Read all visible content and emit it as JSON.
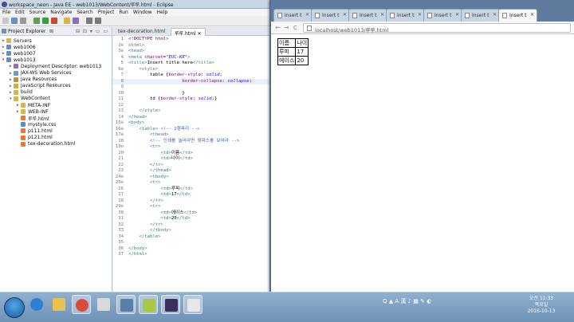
{
  "eclipse": {
    "title": "workspace_neon - Java EE - web1013/WebContent/루루.html - Eclipse",
    "menu": [
      "File",
      "Edit",
      "Source",
      "Navigate",
      "Search",
      "Project",
      "Run",
      "Window",
      "Help"
    ],
    "explorer": {
      "title": "Project Explorer",
      "tab_marker": "⊠",
      "tools": "⊟ ⊡ ▾ ▭ ▭",
      "items": [
        {
          "label": "Servers",
          "indent": 0,
          "twisty": "▸",
          "icon": "folder-icon",
          "color": "#d9b44a"
        },
        {
          "label": "web1006",
          "indent": 0,
          "twisty": "▸",
          "icon": "project-icon",
          "color": "#6c8ebf"
        },
        {
          "label": "web1007",
          "indent": 0,
          "twisty": "▸",
          "icon": "project-icon",
          "color": "#6c8ebf"
        },
        {
          "label": "web1013",
          "indent": 0,
          "twisty": "▾",
          "icon": "project-icon",
          "color": "#6c8ebf"
        },
        {
          "label": "Deployment Descriptor: web1013",
          "indent": 1,
          "twisty": "▸",
          "icon": "descriptor-icon",
          "color": "#8a6fbf"
        },
        {
          "label": "JAX-WS Web Services",
          "indent": 1,
          "twisty": "▸",
          "icon": "webservice-icon",
          "color": "#5aa0d0"
        },
        {
          "label": "Java Resources",
          "indent": 1,
          "twisty": "▸",
          "icon": "java-resources-icon",
          "color": "#c98c3a"
        },
        {
          "label": "JavaScript Resources",
          "indent": 1,
          "twisty": "▸",
          "icon": "js-resources-icon",
          "color": "#c9b23a"
        },
        {
          "label": "build",
          "indent": 1,
          "twisty": "▸",
          "icon": "folder-icon",
          "color": "#d9b44a"
        },
        {
          "label": "WebContent",
          "indent": 1,
          "twisty": "▾",
          "icon": "folder-icon",
          "color": "#d9b44a"
        },
        {
          "label": "META-INF",
          "indent": 2,
          "twisty": "▸",
          "icon": "folder-icon",
          "color": "#d9b44a"
        },
        {
          "label": "WEB-INF",
          "indent": 2,
          "twisty": "▸",
          "icon": "folder-icon",
          "color": "#d9b44a"
        },
        {
          "label": "루루.html",
          "indent": 2,
          "twisty": "",
          "icon": "html-file-icon",
          "color": "#e07a3a"
        },
        {
          "label": "mystyle.css",
          "indent": 2,
          "twisty": "",
          "icon": "css-file-icon",
          "color": "#5a8fd0"
        },
        {
          "label": "p111.html",
          "indent": 2,
          "twisty": "",
          "icon": "html-file-icon",
          "color": "#e07a3a"
        },
        {
          "label": "p121.html",
          "indent": 2,
          "twisty": "",
          "icon": "html-file-icon",
          "color": "#e07a3a"
        },
        {
          "label": "tex-decoration.html",
          "indent": 2,
          "twisty": "",
          "icon": "html-file-icon",
          "color": "#e07a3a"
        }
      ]
    },
    "editor": {
      "tabs": [
        {
          "label": "tex-decoration.html",
          "active": false
        },
        {
          "label": "루루.html ✕",
          "active": true
        }
      ],
      "lines": [
        {
          "n": "1",
          "html": "<span class='cp'>&lt;!DOCTYPE html&gt;</span>"
        },
        {
          "n": "2⊖",
          "html": "<span class='tg'>&lt;html&gt;</span>"
        },
        {
          "n": "3⊖",
          "html": "<span class='tg'>&lt;head&gt;</span>"
        },
        {
          "n": "4",
          "html": "<span class='tg'>&lt;meta</span> <span class='an'>charset</span>=<span class='av'>\"EUC-KR\"</span><span class='tg'>&gt;</span>"
        },
        {
          "n": "5",
          "html": "<span class='tg'>&lt;title&gt;</span><span class='tx'>Insert title here</span><span class='tg'>&lt;/title&gt;</span>"
        },
        {
          "n": "6⊖",
          "html": "    <span class='tg'>&lt;style&gt;</span>"
        },
        {
          "n": "7",
          "html": "        <span class='tx'>table {</span><span class='an'>border-style</span>: <span class='av'>solid</span>;"
        },
        {
          "n": "8",
          "html": "                    <span class='an'>border-collapse</span>: <span class='av'>collapse</span>;",
          "cur": true
        },
        {
          "n": "9",
          "html": " "
        },
        {
          "n": "10",
          "html": "                    <span class='tx'>}</span>"
        },
        {
          "n": "11",
          "html": "        <span class='tx'>td {</span><span class='an'>border-style</span>: <span class='av'>solid</span>;<span class='tx'>}</span>"
        },
        {
          "n": "12",
          "html": " "
        },
        {
          "n": "13",
          "html": "    <span class='tg'>&lt;/style&gt;</span>"
        },
        {
          "n": "14",
          "html": "<span class='tg'>&lt;/head&gt;</span>"
        },
        {
          "n": "15⊖",
          "html": "<span class='tg'>&lt;body&gt;</span>"
        },
        {
          "n": "16⊖",
          "html": "    <span class='tg'>&lt;table&gt;</span> <span class='cm'>&lt;!-- 2행짜리 --&gt;</span>"
        },
        {
          "n": "17⊖",
          "html": "        <span class='tg'>&lt;thead&gt;</span>"
        },
        {
          "n": "18",
          "html": "        <span class='cm'>&lt;!-- 인쇄를 눌러라면 윗파스를 보여라 --&gt;</span>"
        },
        {
          "n": "19⊖",
          "html": "        <span class='tg'>&lt;tr&gt;</span>"
        },
        {
          "n": "20",
          "html": "            <span class='tg'>&lt;td&gt;</span><span class='tx'>이름</span><span class='tg'>&lt;/td&gt;</span>"
        },
        {
          "n": "21",
          "html": "            <span class='tg'>&lt;td&gt;</span><span class='tx'>나이</span><span class='tg'>&lt;/td&gt;</span>"
        },
        {
          "n": "22",
          "html": "        <span class='tg'>&lt;/tr&gt;</span>"
        },
        {
          "n": "23",
          "html": "        <span class='tg'>&lt;/thead&gt;</span>"
        },
        {
          "n": "24⊖",
          "html": "        <span class='tg'>&lt;tbody&gt;</span>"
        },
        {
          "n": "25⊖",
          "html": "        <span class='tg'>&lt;tr&gt;</span>"
        },
        {
          "n": "26",
          "html": "            <span class='tg'>&lt;td&gt;</span><span class='tx'>루피</span><span class='tg'>&lt;/td&gt;</span>"
        },
        {
          "n": "27",
          "html": "            <span class='tg'>&lt;td&gt;</span><span class='tx'>17</span><span class='tg'>&lt;/td&gt;</span>"
        },
        {
          "n": "28",
          "html": "        <span class='tg'>&lt;/tr&gt;</span>"
        },
        {
          "n": "29⊖",
          "html": "        <span class='tg'>&lt;tr&gt;</span>"
        },
        {
          "n": "30",
          "html": "            <span class='tg'>&lt;td&gt;</span><span class='tx'>에이스</span><span class='tg'>&lt;/td&gt;</span>"
        },
        {
          "n": "31",
          "html": "            <span class='tg'>&lt;td&gt;</span><span class='tx'>20</span><span class='tg'>&lt;/td&gt;</span>"
        },
        {
          "n": "32",
          "html": "        <span class='tg'>&lt;/tr&gt;</span>"
        },
        {
          "n": "33",
          "html": "        <span class='tg'>&lt;/tbody&gt;</span>"
        },
        {
          "n": "34",
          "html": "    <span class='tg'>&lt;/table&gt;</span>"
        },
        {
          "n": "35",
          "html": " "
        },
        {
          "n": "36",
          "html": "<span class='tg'>&lt;/body&gt;</span>"
        },
        {
          "n": "37",
          "html": "<span class='tg'>&lt;/html&gt;</span>"
        }
      ]
    }
  },
  "chrome": {
    "tabs": [
      {
        "label": "Insert t",
        "close": "✕",
        "active": false
      },
      {
        "label": "Insert t",
        "close": "✕",
        "active": false
      },
      {
        "label": "Insert t",
        "close": "✕",
        "active": false
      },
      {
        "label": "Insert t",
        "close": "✕",
        "active": false
      },
      {
        "label": "Insert t",
        "close": "✕",
        "active": false
      },
      {
        "label": "Insert t",
        "close": "✕",
        "active": false
      },
      {
        "label": "Insert t",
        "close": "✕",
        "active": true
      }
    ],
    "nav": {
      "back": "←",
      "forward": "→",
      "reload": "C"
    },
    "url": "localhost/web1013/루루.html",
    "table": [
      [
        "이름",
        "나이"
      ],
      [
        "루피",
        "17"
      ],
      [
        "에이스",
        "20"
      ]
    ]
  },
  "taskbar": {
    "apps": [
      {
        "name": "ie-icon",
        "color": "#2f7fd3",
        "active": false
      },
      {
        "name": "explorer-folder-icon",
        "color": "#e8c250",
        "active": false
      },
      {
        "name": "chrome-icon",
        "color": "#d94c3a",
        "active": true
      },
      {
        "name": "media-player-icon",
        "color": "#d9d9d9",
        "active": false
      },
      {
        "name": "window-app-icon",
        "color": "#5a7ea8",
        "active": true
      },
      {
        "name": "notepad-icon",
        "color": "#a8c84a",
        "active": true
      },
      {
        "name": "eclipse-icon",
        "color": "#3c2f5c",
        "active": true
      },
      {
        "name": "paint-icon",
        "color": "#e8e8e8",
        "active": true
      }
    ],
    "tray_icons": "Q ▲ A 漢 ♪ ▦ ✎ ◐",
    "clock": {
      "ampm_time": "오전 11:33",
      "weekday": "목요일",
      "date": "2016-10-13"
    }
  }
}
